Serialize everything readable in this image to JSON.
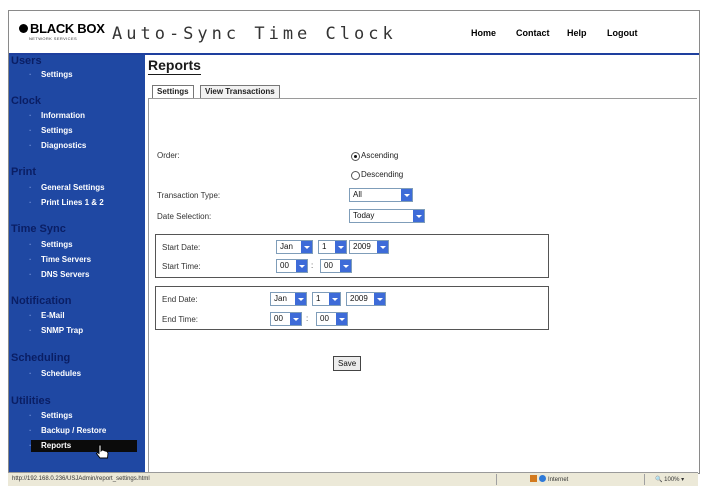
{
  "header": {
    "brand_name": "BLACK BOX",
    "brand_tagline": "NETWORK SERVICES",
    "app_title": "Auto-Sync Time Clock",
    "nav": [
      "Home",
      "Contact",
      "Help",
      "Logout"
    ]
  },
  "sidebar": {
    "sections": [
      {
        "title": "Users",
        "items": [
          "Settings"
        ]
      },
      {
        "title": "Clock",
        "items": [
          "Information",
          "Settings",
          "Diagnostics"
        ]
      },
      {
        "title": "Print",
        "items": [
          "General Settings",
          "Print Lines 1 & 2"
        ]
      },
      {
        "title": "Time Sync",
        "items": [
          "Settings",
          "Time Servers",
          "DNS Servers"
        ]
      },
      {
        "title": "Notification",
        "items": [
          "E-Mail",
          "SNMP Trap"
        ]
      },
      {
        "title": "Scheduling",
        "items": [
          "Schedules"
        ]
      },
      {
        "title": "Utilities",
        "items": [
          "Settings",
          "Backup / Restore",
          "Reports"
        ]
      }
    ],
    "active_item": "Reports"
  },
  "main": {
    "title": "Reports",
    "tabs": [
      "Settings",
      "View Transactions"
    ],
    "active_tab": "Settings",
    "form": {
      "order_label": "Order:",
      "order_options": [
        "Ascending",
        "Descending"
      ],
      "order_selected": "Ascending",
      "transaction_type_label": "Transaction Type:",
      "transaction_type_value": "All",
      "date_selection_label": "Date Selection:",
      "date_selection_value": "Today",
      "start_date_label": "Start Date:",
      "start_date": {
        "month": "Jan",
        "day": "1",
        "year": "2009"
      },
      "start_time_label": "Start Time:",
      "start_time": {
        "hour": "00",
        "minute": "00"
      },
      "end_date_label": "End Date:",
      "end_date": {
        "month": "Jan",
        "day": "1",
        "year": "2009"
      },
      "end_time_label": "End Time:",
      "end_time": {
        "hour": "00",
        "minute": "00"
      },
      "time_separator": ":",
      "save_label": "Save"
    }
  },
  "statusbar": {
    "url": "http://192.168.0.236/USJAdmin/report_settings.html",
    "zone": "Internet",
    "zoom": "100%"
  },
  "colors": {
    "sidebar_bg": "#1f48a3",
    "section_title": "#0a1e64",
    "select_arrow": "#3d6bd8"
  }
}
